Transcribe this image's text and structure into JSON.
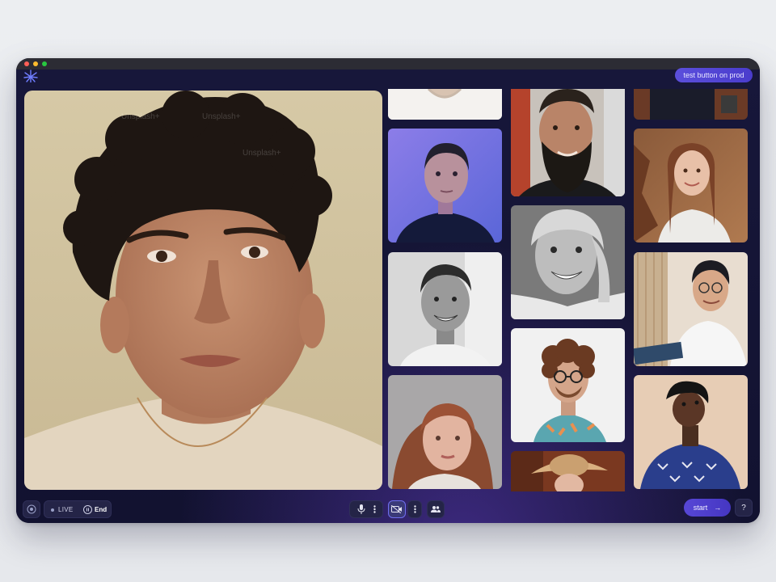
{
  "window": {
    "header": {
      "test_button_label": "test button on prod"
    },
    "main_participant": {
      "name": "",
      "watermarks": [
        "Unsplash+",
        "Unsplash+",
        "Unsplash+"
      ]
    },
    "participants": [
      {
        "id": "p1",
        "desc": "white shirt cropped"
      },
      {
        "id": "p2",
        "desc": "woman blue light"
      },
      {
        "id": "p3",
        "desc": "man smiling grayscale"
      },
      {
        "id": "p4",
        "desc": "woman freckles"
      },
      {
        "id": "p5",
        "desc": "bearded man"
      },
      {
        "id": "p6",
        "desc": "woman grayscale smiling"
      },
      {
        "id": "p7",
        "desc": "man curly glasses"
      },
      {
        "id": "p8",
        "desc": "woman hat"
      },
      {
        "id": "p9",
        "desc": "dark top cropped"
      },
      {
        "id": "p10",
        "desc": "woman long hair autumn"
      },
      {
        "id": "p11",
        "desc": "man glasses reading"
      },
      {
        "id": "p12",
        "desc": "woman looking up"
      }
    ],
    "controls": {
      "live_label": "LIVE",
      "end_label": "End",
      "start_label": "start",
      "help_label": "?",
      "start_arrow": "→"
    },
    "colors": {
      "accent": "#5747d6",
      "background": "#141431",
      "control": "#242447"
    }
  }
}
